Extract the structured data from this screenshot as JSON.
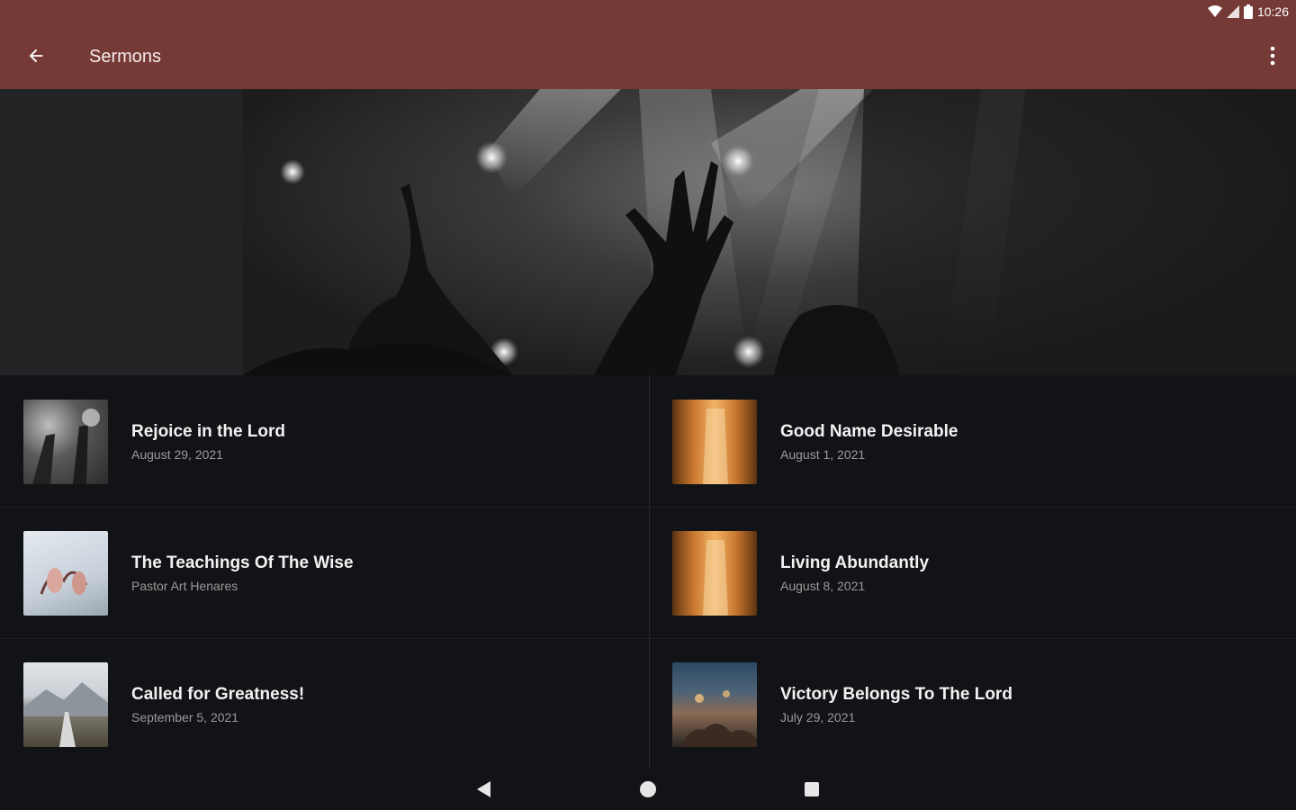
{
  "status_bar": {
    "time": "10:26"
  },
  "app_bar": {
    "title": "Sermons"
  },
  "sermons": [
    {
      "title": "Rejoice in the Lord",
      "subtitle": "August 29, 2021"
    },
    {
      "title": "Good Name Desirable",
      "subtitle": "August 1, 2021"
    },
    {
      "title": "The Teachings Of The Wise",
      "subtitle": "Pastor Art Henares"
    },
    {
      "title": "Living Abundantly",
      "subtitle": "August 8, 2021"
    },
    {
      "title": "Called for Greatness!",
      "subtitle": "September 5, 2021"
    },
    {
      "title": "Victory Belongs To The Lord",
      "subtitle": "July 29, 2021"
    }
  ],
  "colors": {
    "accent": "#763a36",
    "background": "#121316"
  }
}
